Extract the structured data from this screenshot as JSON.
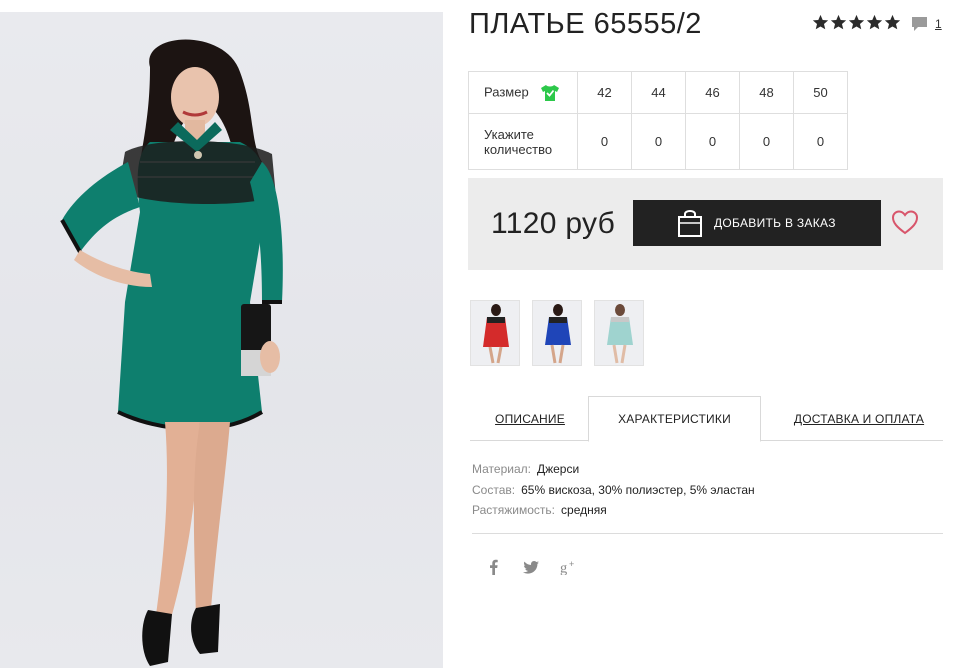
{
  "product": {
    "title": "ПЛАТЬЕ 65555/2",
    "rating_stars": 5,
    "comment_count": "1"
  },
  "size_table": {
    "size_label": "Размер",
    "sizes": [
      "42",
      "44",
      "46",
      "48",
      "50"
    ],
    "qty_label_line1": "Укажите",
    "qty_label_line2": "количество",
    "quantities": [
      "0",
      "0",
      "0",
      "0",
      "0"
    ]
  },
  "buy": {
    "price": "1120 руб",
    "add_button_label": "ДОБАВИТЬ В ЗАКАЗ"
  },
  "thumbnails": [
    {
      "color": "#d42b2b"
    },
    {
      "color": "#1f45b8"
    },
    {
      "color": "#9fd3cf"
    }
  ],
  "tabs": [
    {
      "label": "ОПИСАНИЕ",
      "active": false
    },
    {
      "label": "ХАРАКТЕРИСТИКИ",
      "active": true
    },
    {
      "label": "ДОСТАВКА И ОПЛАТА",
      "active": false
    }
  ],
  "characteristics": [
    {
      "key": "Материал:",
      "value": "Джерси"
    },
    {
      "key": "Состав:",
      "value": "65% вискоза, 30% полиэстер, 5% эластан"
    },
    {
      "key": "Растяжимость:",
      "value": "средняя"
    }
  ],
  "social": [
    "facebook-icon",
    "twitter-icon",
    "google-plus-icon"
  ],
  "colors": {
    "dress_main": "#0e7f6e",
    "button_bg": "#222222",
    "buybox_bg": "#ececec",
    "heart": "#d8556b",
    "size_check": "#2cc84a"
  }
}
